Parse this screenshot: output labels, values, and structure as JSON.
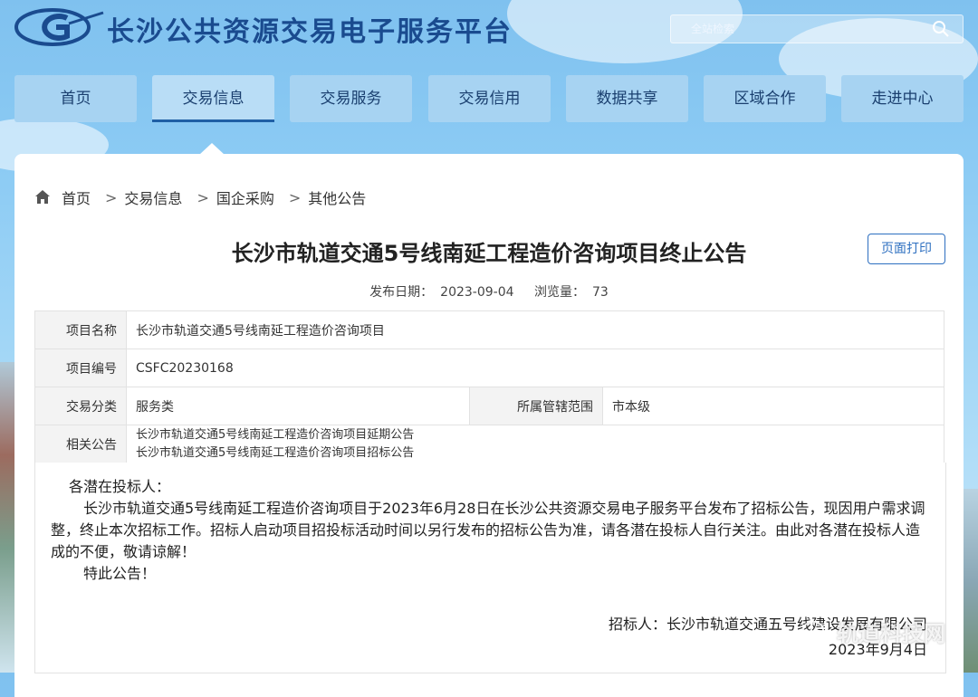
{
  "site": {
    "name": "长沙公共资源交易电子服务平台",
    "search_placeholder": "全站检索"
  },
  "nav": {
    "items": [
      {
        "label": "首页"
      },
      {
        "label": "交易信息"
      },
      {
        "label": "交易服务"
      },
      {
        "label": "交易信用"
      },
      {
        "label": "数据共享"
      },
      {
        "label": "区域合作"
      },
      {
        "label": "走进中心"
      }
    ],
    "active_index": 1
  },
  "breadcrumb": {
    "items": [
      "首页",
      "交易信息",
      "国企采购",
      "其他公告"
    ],
    "separator": ">"
  },
  "article": {
    "title": "长沙市轨道交通5号线南延工程造价咨询项目终止公告",
    "print_label": "页面打印",
    "date_label": "发布日期：",
    "date": "2023-09-04",
    "views_label": "浏览量：",
    "views": "73"
  },
  "info_table": {
    "project_name_label": "项目名称",
    "project_name": "长沙市轨道交通5号线南延工程造价咨询项目",
    "project_code_label": "项目编号",
    "project_code": "CSFC20230168",
    "category_label": "交易分类",
    "category": "服务类",
    "scope_label": "所属管辖范围",
    "scope": "市本级",
    "related_label": "相关公告",
    "related": [
      "长沙市轨道交通5号线南延工程造价咨询项目延期公告",
      "长沙市轨道交通5号线南延工程造价咨询项目招标公告"
    ]
  },
  "content": {
    "salutation": "各潜在投标人：",
    "paragraph": "长沙市轨道交通5号线南延工程造价咨询项目于2023年6月28日在长沙公共资源交易电子服务平台发布了招标公告，现因用户需求调整，终止本次招标工作。招标人启动项目招投标活动时间以另行发布的招标公告为准，请各潜在投标人自行关注。由此对各潜在投标人造成的不便，敬请谅解！",
    "closing": "特此公告！",
    "signer": "招标人：长沙市轨道交通五号线建设发展有限公司",
    "sign_date": "2023年9月4日"
  },
  "watermark": {
    "text": "轨道科技网",
    "icon": "wechat-icon"
  },
  "colors": {
    "brand_blue": "#1a4b8f",
    "nav_bg": "#a7d3f2",
    "nav_active_underline": "#1f5fa5",
    "print_button": "#2d6fc0"
  }
}
